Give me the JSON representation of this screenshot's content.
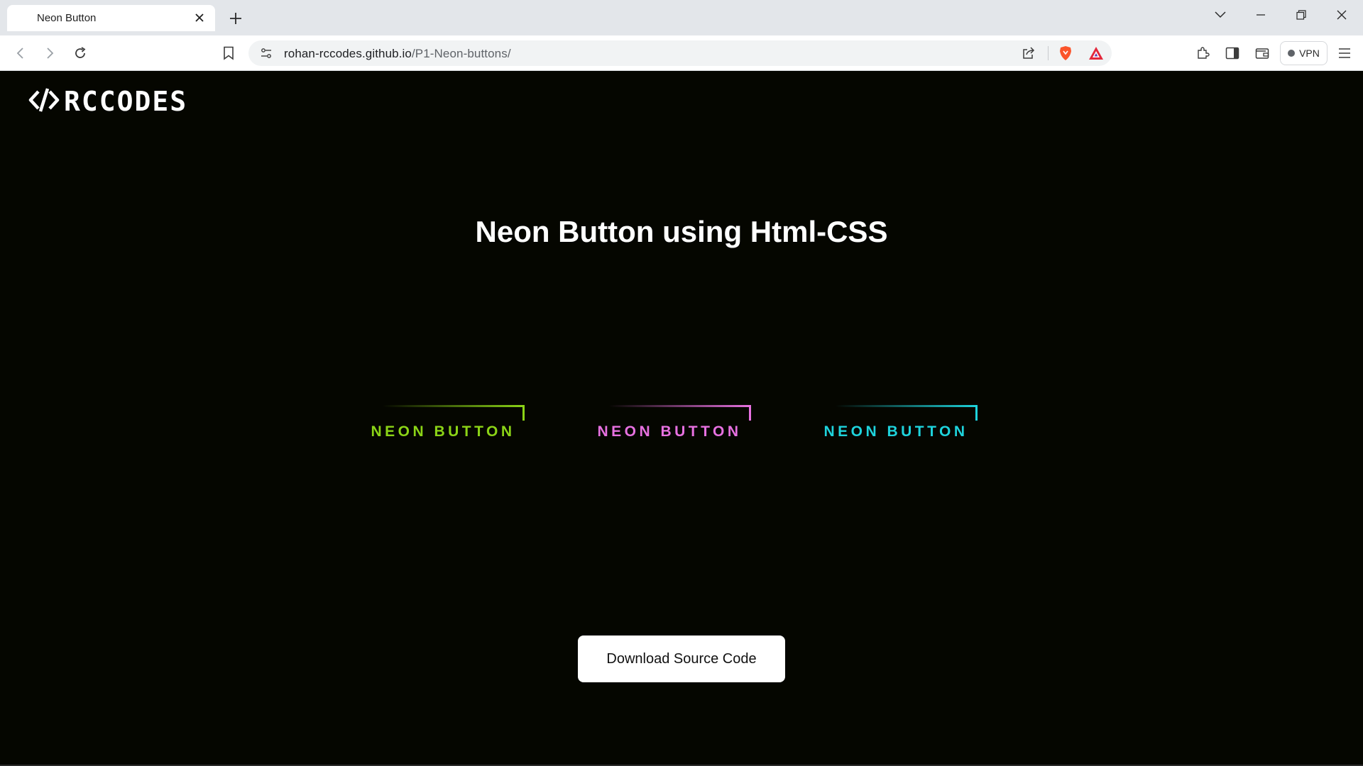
{
  "browser": {
    "tab_title": "Neon Button",
    "url_host": "rohan-rccodes.github.io",
    "url_path": "/P1-Neon-buttons/",
    "vpn_label": "VPN",
    "icons": [
      "back-icon",
      "forward-icon",
      "reload-icon",
      "bookmark-icon",
      "site-info-icon",
      "share-icon",
      "brave-shields-icon",
      "brave-rewards-icon",
      "extensions-icon",
      "sidebar-icon",
      "wallet-icon",
      "menu-icon",
      "tab-search-icon",
      "minimize-icon",
      "restore-icon",
      "close-icon"
    ]
  },
  "page": {
    "logo_text": "RCCODES",
    "headline": "Neon Button using Html-CSS",
    "neon_buttons": [
      {
        "label": "NEON BUTTON",
        "color": "#8bd316"
      },
      {
        "label": "NEON BUTTON",
        "color": "#e771e0"
      },
      {
        "label": "NEON BUTTON",
        "color": "#1ed3dc"
      }
    ],
    "download_label": "Download Source Code"
  },
  "colors": {
    "page_bg": "#050600",
    "chrome_bg": "#e3e6ea",
    "brave_orange": "#fb542b",
    "rewards_red": "#e3283c"
  }
}
